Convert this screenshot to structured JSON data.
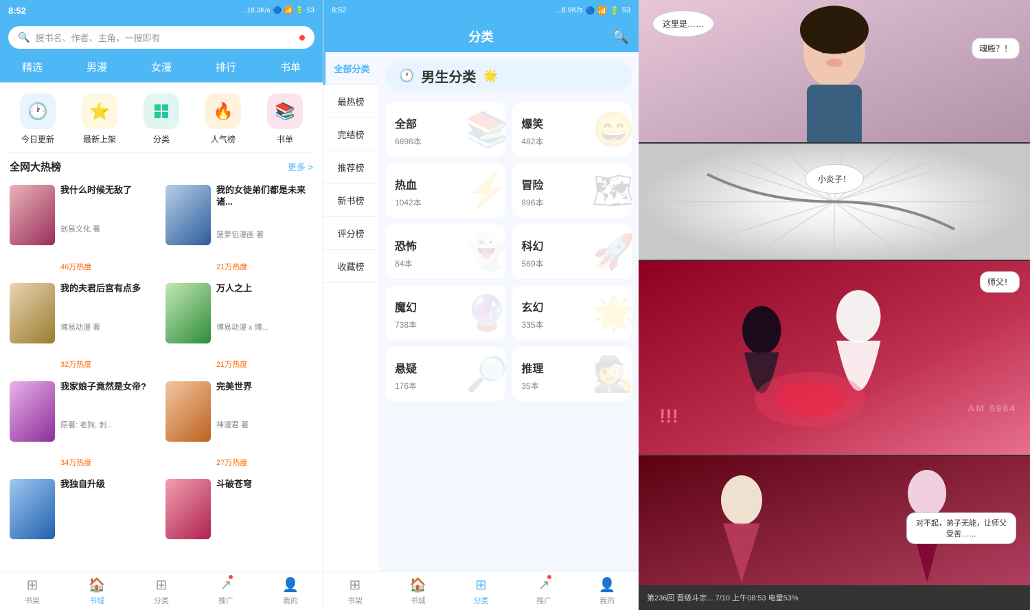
{
  "leftPanel": {
    "statusBar": {
      "time": "8:52",
      "signal": "...18.3K/s",
      "battery": "53"
    },
    "searchPlaceholder": "搜书名、作者、主角，一搜即有",
    "navTabs": [
      {
        "label": "精选",
        "active": false
      },
      {
        "label": "男漫",
        "active": false
      },
      {
        "label": "女漫",
        "active": false
      },
      {
        "label": "排行",
        "active": false
      },
      {
        "label": "书单",
        "active": false
      }
    ],
    "icons": [
      {
        "label": "今日更新",
        "icon": "🕐",
        "color": "ic-blue"
      },
      {
        "label": "最新上架",
        "icon": "⭐",
        "color": "ic-yellow"
      },
      {
        "label": "分类",
        "icon": "⚙️",
        "color": "ic-teal"
      },
      {
        "label": "人气榜",
        "icon": "🔥",
        "color": "ic-orange"
      },
      {
        "label": "书单",
        "icon": "📚",
        "color": "ic-pink"
      }
    ],
    "sectionTitle": "全网大热榜",
    "moreLabel": "更多 >",
    "books": [
      {
        "title": "我什么时候无敌了",
        "author": "创易文化 著",
        "hot": "46万热度",
        "cover": "cover-1"
      },
      {
        "title": "我的女徒弟们都是未来诸...",
        "author": "菠萝包漫画 著",
        "hot": "21万热度",
        "cover": "cover-2"
      },
      {
        "title": "我的夫君后宫有点多",
        "author": "博易动漫 著",
        "hot": "32万热度",
        "cover": "cover-3"
      },
      {
        "title": "万人之上",
        "author": "博易动漫 x 博...",
        "hot": "21万热度",
        "cover": "cover-4"
      },
      {
        "title": "我家娘子竟然是女帝?",
        "author": "原著: 老狗, 刺...",
        "hot": "34万热度",
        "cover": "cover-5"
      },
      {
        "title": "完美世界",
        "author": "神漫君 著",
        "hot": "27万热度",
        "cover": "cover-6"
      },
      {
        "title": "我独自升级",
        "author": "",
        "hot": "",
        "cover": "cover-7"
      },
      {
        "title": "斗破苍穹",
        "author": "",
        "hot": "",
        "cover": "cover-8"
      }
    ],
    "bottomNav": [
      {
        "label": "书架",
        "icon": "⊞",
        "active": false
      },
      {
        "label": "书城",
        "icon": "🏠",
        "active": true,
        "dot": false
      },
      {
        "label": "分类",
        "icon": "⊞",
        "active": false
      },
      {
        "label": "推广",
        "icon": "↗",
        "active": false,
        "dot": true
      },
      {
        "label": "我的",
        "icon": "👤",
        "active": false
      }
    ]
  },
  "middlePanel": {
    "statusBar": {
      "time": "8:52",
      "signal": "...8.9K/s",
      "battery": "53"
    },
    "title": "分类",
    "sidebarItems": [
      {
        "label": "全部分类",
        "active": true
      },
      {
        "label": "最热榜",
        "active": false
      },
      {
        "label": "完结榜",
        "active": false
      },
      {
        "label": "推荐榜",
        "active": false
      },
      {
        "label": "新书榜",
        "active": false
      },
      {
        "label": "评分榜",
        "active": false
      },
      {
        "label": "收藏榜",
        "active": false
      }
    ],
    "categoryHeader": {
      "icon": "🕐",
      "title": "男生分类",
      "emoji": "🌟"
    },
    "categories": [
      {
        "title": "全部",
        "count": "6898本"
      },
      {
        "title": "爆笑",
        "count": "482本"
      },
      {
        "title": "热血",
        "count": "1042本"
      },
      {
        "title": "冒险",
        "count": "896本"
      },
      {
        "title": "恐怖",
        "count": "84本"
      },
      {
        "title": "科幻",
        "count": "569本"
      },
      {
        "title": "魔幻",
        "count": "738本"
      },
      {
        "title": "玄幻",
        "count": "335本"
      },
      {
        "title": "悬疑",
        "count": "176本"
      },
      {
        "title": "推理",
        "count": "35本"
      }
    ],
    "bottomNav": [
      {
        "label": "书架",
        "icon": "⊞",
        "active": false
      },
      {
        "label": "书城",
        "icon": "🏠",
        "active": false
      },
      {
        "label": "分类",
        "icon": "⊞",
        "active": true,
        "dot": false
      },
      {
        "label": "推广",
        "icon": "↗",
        "active": false,
        "dot": true
      },
      {
        "label": "我的",
        "icon": "👤",
        "active": false
      }
    ]
  },
  "rightPanel": {
    "pages": [
      {
        "bubbles": [
          {
            "text": "这里是……",
            "position": "top-left"
          },
          {
            "text": "魂殿？！",
            "position": "top-right"
          }
        ]
      },
      {
        "bubbles": [
          {
            "text": "小炎子！",
            "position": "center"
          }
        ]
      },
      {
        "bubbles": [
          {
            "text": "师父！",
            "position": "top-right"
          }
        ]
      },
      {
        "bubbles": [
          {
            "text": "对不起，弟子无能，让师父受苦……",
            "position": "bottom-right"
          }
        ]
      }
    ],
    "bottomBar": "第236回 晋级斗宗... 7/10 上午08:53 电量53%",
    "watermark": "AM 8964"
  }
}
